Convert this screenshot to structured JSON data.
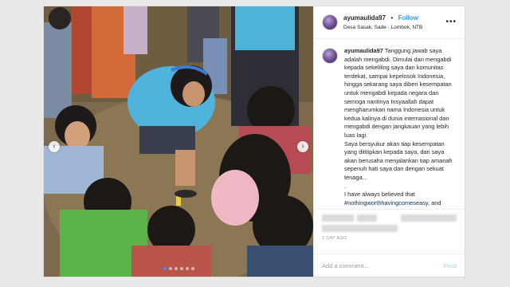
{
  "post": {
    "username": "ayumaulida97",
    "separator": "•",
    "follow_label": "Follow",
    "location": "Desa Sasak, Sade - Lombok, NTB",
    "more_icon": "more-horizontal-icon",
    "caption_user": "ayumaulida97",
    "caption_text": " Tanggung jawab saya adalah mengabdi. Dimulai dari mengabdi kepada sekeliling saya dan komunitas terdekat, sampai kepelosok Indonesia, hingga sekarang saya diberi kesempatan untuk mengabdi kepada negara dan semoga nantinya Insyaallah dapat mengharumkan nama Indonesia untuk kedua kalinya di dunia internasional dan mengabdi dengan jangkauan yang lebih luas lagi.\nSaya bersyukur akan tiap kesempatan yang dititipkan kepada saya, dan saya akan berusaha menjalankan tiap amanah sepenuh hati saya dan dengan sekuat tenaga...\n.\nI have always believed that ",
    "caption_hashtag": "#nothingworthhavingcomeseasy",
    "caption_tail": ", and",
    "timestamp": "1 DAY AGO",
    "add_comment_placeholder": "Add a comment...",
    "post_label": "Post"
  },
  "photo": {
    "nav_left_icon": "chevron-left-icon",
    "nav_right_icon": "chevron-right-icon",
    "dot_count": 6,
    "active_dot": 0,
    "nav_left_glyph": "‹",
    "nav_right_glyph": "›"
  },
  "colors": {
    "accent": "#3897f0",
    "hashtag": "#003569",
    "border": "#dbdbdb",
    "muted": "#999999"
  }
}
